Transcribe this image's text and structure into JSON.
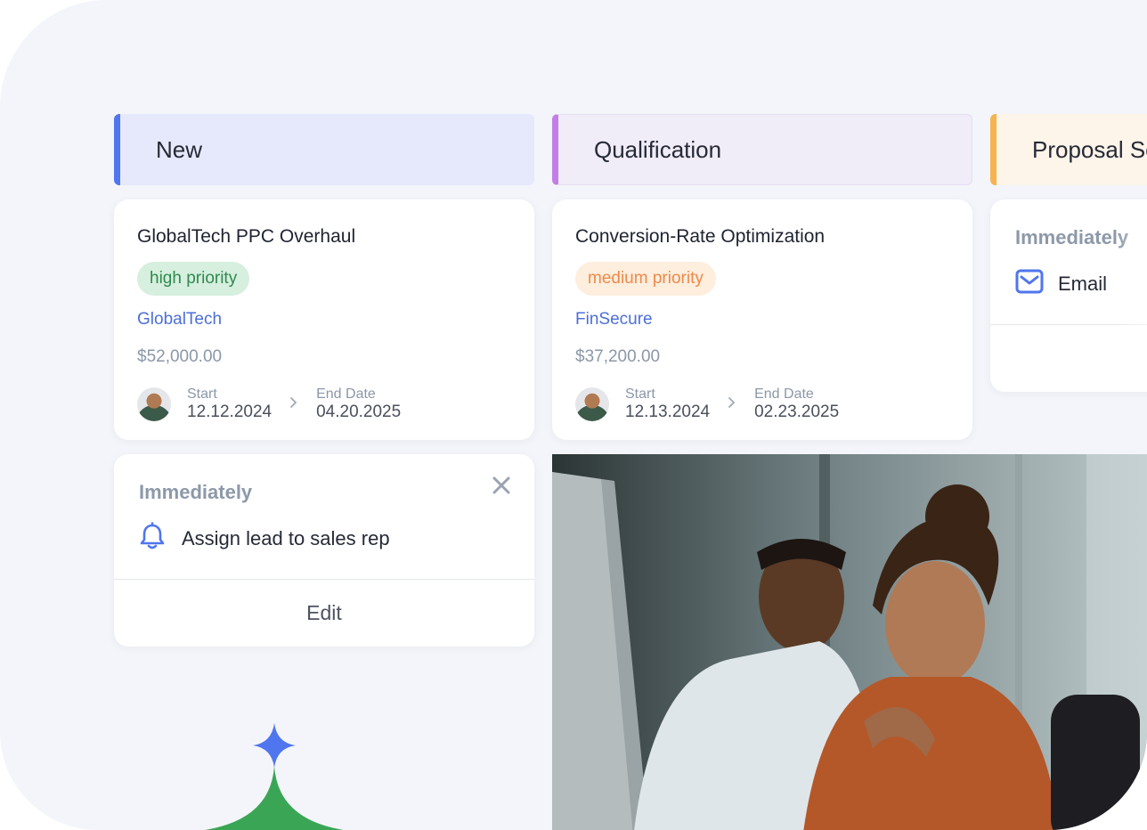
{
  "columns": [
    {
      "title": "New"
    },
    {
      "title": "Qualification"
    },
    {
      "title": "Proposal Se"
    }
  ],
  "deals": [
    {
      "title": "GlobalTech PPC Overhaul",
      "priority": "high priority",
      "company": "GlobalTech",
      "amount": "$52,000.00",
      "start_label": "Start",
      "start_date": "12.12.2024",
      "end_label": "End Date",
      "end_date": "04.20.2025"
    },
    {
      "title": "Conversion-Rate Optimization",
      "priority": "medium priority",
      "company": "FinSecure",
      "amount": "$37,200.00",
      "start_label": "Start",
      "start_date": "12.13.2024",
      "end_label": "End Date",
      "end_date": "02.23.2025"
    }
  ],
  "action_card": {
    "timing": "Immediately",
    "action": "Assign lead to sales rep",
    "edit_label": "Edit",
    "icon": "bell-icon"
  },
  "proposal_card": {
    "timing": "Immediately",
    "action": "Email",
    "icon": "mail-icon"
  },
  "colors": {
    "new_accent": "#4f76ee",
    "qualification_accent": "#c27ee6",
    "proposal_accent": "#f6b34f",
    "high_priority": "#2f8a4d",
    "medium_priority": "#ee8a4b",
    "link": "#4c6fd8",
    "sparkle_blue": "#4f76ee",
    "sparkle_green": "#3aa655"
  }
}
